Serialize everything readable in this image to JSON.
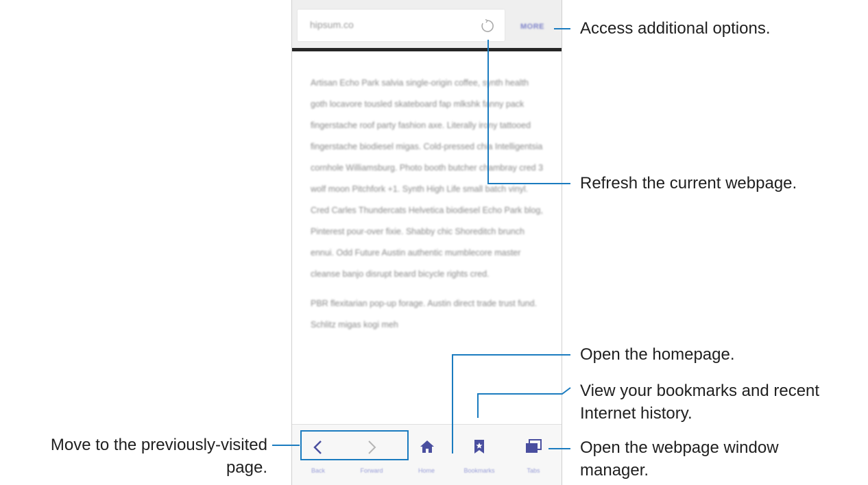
{
  "browser": {
    "url": "hipsum.co",
    "more_label": "MORE",
    "body_paragraphs": [
      "Artisan Echo Park salvia single-origin coffee, synth health goth locavore tousled skateboard fap mlkshk fanny pack fingerstache roof party fashion axe. Literally irony tattooed fingerstache biodiesel migas. Cold-pressed chia Intelligentsia cornhole Williamsburg. Photo booth butcher chambray cred 3 wolf moon Pitchfork +1. Synth High Life small batch vinyl. Cred Carles Thundercats Helvetica biodiesel Echo Park blog, Pinterest pour-over fixie. Shabby chic Shoreditch brunch ennui. Odd Future Austin authentic mumblecore master cleanse banjo disrupt beard bicycle rights cred.",
      "PBR flexitarian pop-up forage. Austin direct trade trust fund. Schlitz migas kogi meh"
    ],
    "bottom_nav": {
      "back_label": "Back",
      "forward_label": "Forward",
      "home_label": "Home",
      "bookmarks_label": "Bookmarks",
      "tabs_label": "Tabs"
    },
    "accent_color": "#1a7bbf",
    "icon_color": "#4a4f9f"
  },
  "annotations": {
    "more": "Access additional options.",
    "refresh": "Refresh the current webpage.",
    "home": "Open the homepage.",
    "bookmarks_line1": "View your bookmarks and recent",
    "bookmarks_line2": "Internet history.",
    "tabs_line1": "Open the webpage window",
    "tabs_line2": "manager.",
    "back_line1": "Move to the previously-visited",
    "back_line2": "page."
  }
}
